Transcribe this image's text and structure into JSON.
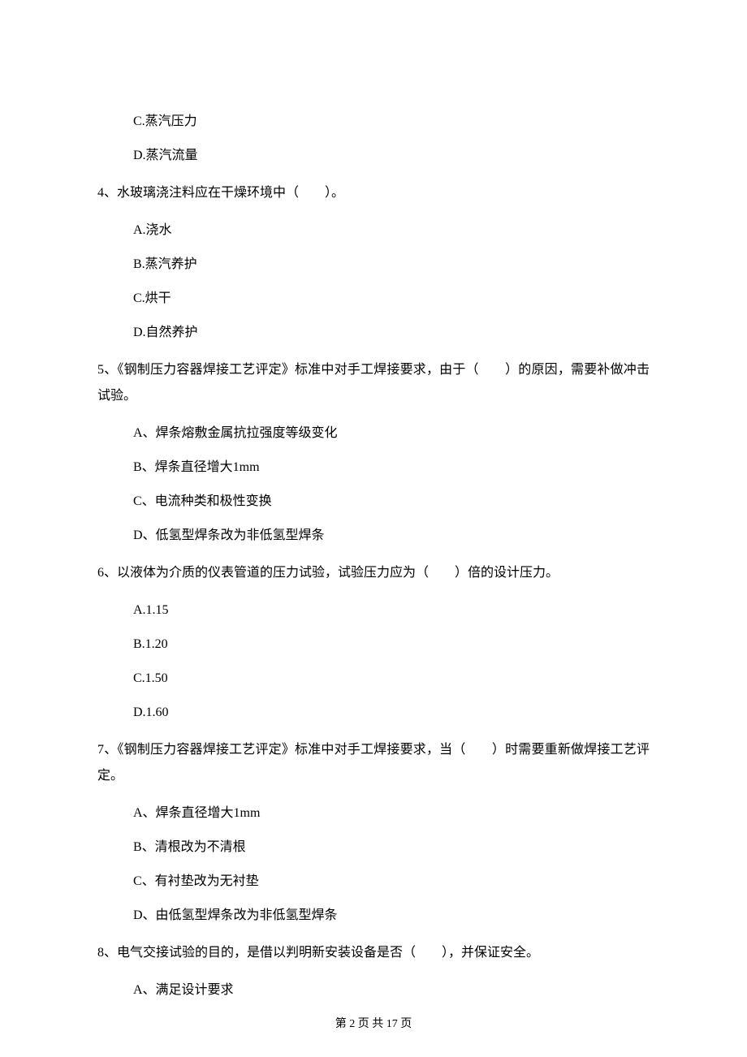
{
  "q3_continued": {
    "options": {
      "c": "C.蒸汽压力",
      "d": "D.蒸汽流量"
    }
  },
  "q4": {
    "text": "4、水玻璃浇注料应在干燥环境中（　　）。",
    "options": {
      "a": "A.浇水",
      "b": "B.蒸汽养护",
      "c": "C.烘干",
      "d": "D.自然养护"
    }
  },
  "q5": {
    "text": "5、《钢制压力容器焊接工艺评定》标准中对手工焊接要求，由于（　　）的原因，需要补做冲击试验。",
    "options": {
      "a": "A、焊条熔敷金属抗拉强度等级变化",
      "b": "B、焊条直径增大1mm",
      "c": "C、电流种类和极性变换",
      "d": "D、低氢型焊条改为非低氢型焊条"
    }
  },
  "q6": {
    "text": "6、以液体为介质的仪表管道的压力试验，试验压力应为（　　）倍的设计压力。",
    "options": {
      "a": "A.1.15",
      "b": "B.1.20",
      "c": "C.1.50",
      "d": "D.1.60"
    }
  },
  "q7": {
    "text": "7、《钢制压力容器焊接工艺评定》标准中对手工焊接要求，当（　　）时需要重新做焊接工艺评定。",
    "options": {
      "a": "A、焊条直径增大1mm",
      "b": "B、清根改为不清根",
      "c": "C、有衬垫改为无衬垫",
      "d": "D、由低氢型焊条改为非低氢型焊条"
    }
  },
  "q8": {
    "text": "8、电气交接试验的目的，是借以判明新安装设备是否（　　），并保证安全。",
    "options": {
      "a": "A、满足设计要求"
    }
  },
  "footer": "第 2 页 共 17 页"
}
